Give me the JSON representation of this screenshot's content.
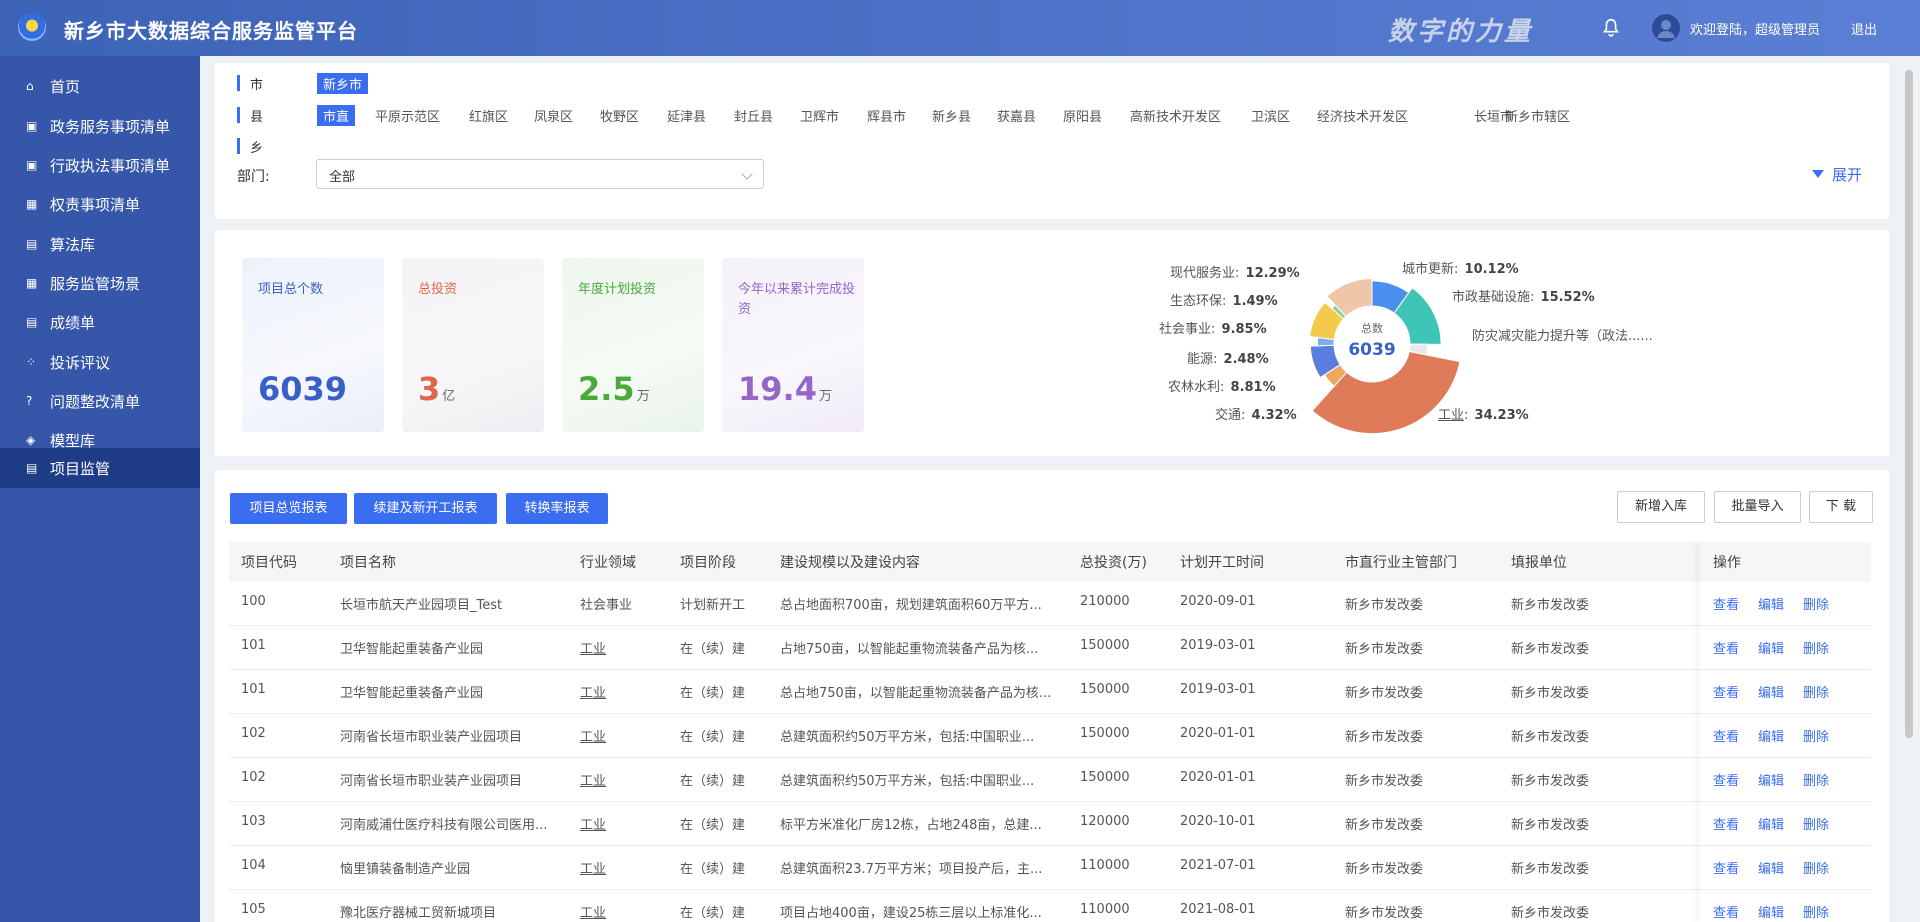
{
  "header": {
    "title": "新乡市大数据综合服务监管平台",
    "slogan": "数字的力量",
    "welcome": "欢迎登陆，超级管理员",
    "logout": "退出"
  },
  "sidebar": {
    "items": [
      {
        "label": "首页",
        "icon": "home-icon"
      },
      {
        "label": "政务服务事项清单",
        "icon": "list-icon"
      },
      {
        "label": "行政执法事项清单",
        "icon": "list-icon"
      },
      {
        "label": "权责事项清单",
        "icon": "calendar-icon"
      },
      {
        "label": "算法库",
        "icon": "document-icon"
      },
      {
        "label": "服务监管场景",
        "icon": "grid-icon"
      },
      {
        "label": "成绩单",
        "icon": "document-icon"
      },
      {
        "label": "投诉评议",
        "icon": "apps-icon"
      },
      {
        "label": "问题整改清单",
        "icon": "question-icon"
      },
      {
        "label": "模型库",
        "icon": "cube-icon"
      },
      {
        "label": "项目监管",
        "icon": "document-icon"
      }
    ],
    "active_index": 10
  },
  "filters": {
    "city_label": "市",
    "city_value": "新乡市",
    "county_label": "县",
    "counties": [
      "市直",
      "平原示范区",
      "红旗区",
      "凤泉区",
      "牧野区",
      "延津县",
      "封丘县",
      "卫辉市",
      "辉县市",
      "新乡县",
      "获嘉县",
      "原阳县",
      "高新技术开发区",
      "卫滨区",
      "经济技术开发区",
      "长垣市",
      "新乡市辖区"
    ],
    "township_label": "乡",
    "dept_label": "部门:",
    "dept_value": "全部",
    "expand_label": "展开"
  },
  "stats": [
    {
      "label": "项目总个数",
      "value": "6039",
      "unit": "",
      "color": "#3a5fc8"
    },
    {
      "label": "总投资",
      "value": "3",
      "unit": "亿",
      "color": "#e0654a"
    },
    {
      "label": "年度计划投资",
      "value": "2.5",
      "unit": "万",
      "color": "#4aa83c"
    },
    {
      "label": "今年以来累计完成投资",
      "value": "19.4",
      "unit": "万",
      "color": "#9467c6"
    }
  ],
  "chart_data": {
    "type": "pie",
    "center_label": "总数",
    "center_value": "6039",
    "slices": [
      {
        "name": "城市更新",
        "percent": 10.12,
        "label": "10.12%",
        "color": "#4a8ef0"
      },
      {
        "name": "市政基础设施",
        "percent": 15.52,
        "label": "15.52%",
        "color": "#3ec5b7"
      },
      {
        "name": "防灾减灾能力提升等（政法......",
        "percent": 3.14,
        "label": "",
        "color": "#e8e8e8"
      },
      {
        "name": "工业",
        "percent": 34.23,
        "label": "34.23%",
        "color": "#e07b5a"
      },
      {
        "name": "交通",
        "percent": 4.32,
        "label": "4.32%",
        "color": "#f0a860"
      },
      {
        "name": "农林水利",
        "percent": 8.81,
        "label": "8.81%",
        "color": "#5b7de0"
      },
      {
        "name": "能源",
        "percent": 2.48,
        "label": "2.48%",
        "color": "#7ab0f0"
      },
      {
        "name": "社会事业",
        "percent": 9.85,
        "label": "9.85%",
        "color": "#f5c94a"
      },
      {
        "name": "生态环保",
        "percent": 1.49,
        "label": "1.49%",
        "color": "#8fd18f"
      },
      {
        "name": "现代服务业",
        "percent": 12.29,
        "label": "12.29%",
        "color": "#f0c6a8"
      }
    ]
  },
  "actions": {
    "report1": "项目总览报表",
    "report2": "续建及新开工报表",
    "report3": "转换率报表",
    "add": "新增入库",
    "import": "批量导入",
    "download": "下 载"
  },
  "table": {
    "columns": [
      "项目代码",
      "项目名称",
      "行业领域",
      "项目阶段",
      "建设规模以及建设内容",
      "总投资(万)",
      "计划开工时间",
      "市直行业主管部门",
      "填报单位",
      "操作"
    ],
    "row_actions": [
      "查看",
      "编辑",
      "删除"
    ],
    "rows": [
      [
        "100",
        "长垣市航天产业园项目_Test",
        "社会事业",
        "计划新开工",
        "总占地面积700亩，规划建筑面积60万平方...",
        "210000",
        "2020-09-01",
        "新乡市发改委",
        "新乡市发改委"
      ],
      [
        "101",
        "卫华智能起重装备产业园",
        "工业",
        "在（续）建",
        "占地750亩，以智能起重物流装备产品为核...",
        "150000",
        "2019-03-01",
        "新乡市发改委",
        "新乡市发改委"
      ],
      [
        "101",
        "卫华智能起重装备产业园",
        "工业",
        "在（续）建",
        "总占地750亩，以智能起重物流装备产品为核...",
        "150000",
        "2019-03-01",
        "新乡市发改委",
        "新乡市发改委"
      ],
      [
        "102",
        "河南省长垣市职业装产业园项目",
        "工业",
        "在（续）建",
        "总建筑面积约50万平方米，包括:中国职业...",
        "150000",
        "2020-01-01",
        "新乡市发改委",
        "新乡市发改委"
      ],
      [
        "102",
        "河南省长垣市职业装产业园项目",
        "工业",
        "在（续）建",
        "总建筑面积约50万平方米，包括:中国职业...",
        "150000",
        "2020-01-01",
        "新乡市发改委",
        "新乡市发改委"
      ],
      [
        "103",
        "河南威浦仕医疗科技有限公司医用...",
        "工业",
        "在（续）建",
        "标平方米准化厂房12栋，占地248亩，总建...",
        "120000",
        "2020-10-01",
        "新乡市发改委",
        "新乡市发改委"
      ],
      [
        "104",
        "恼里镇装备制造产业园",
        "工业",
        "在（续）建",
        "总建筑面积23.7万平方米；项目投产后，主...",
        "110000",
        "2021-07-01",
        "新乡市发改委",
        "新乡市发改委"
      ],
      [
        "105",
        "豫北医疗器械工贸新城项目",
        "工业",
        "在（续）建",
        "项目占地400亩，建设25栋三层以上标准化...",
        "110000",
        "2021-08-01",
        "新乡市发改委",
        "新乡市发改委"
      ]
    ]
  }
}
